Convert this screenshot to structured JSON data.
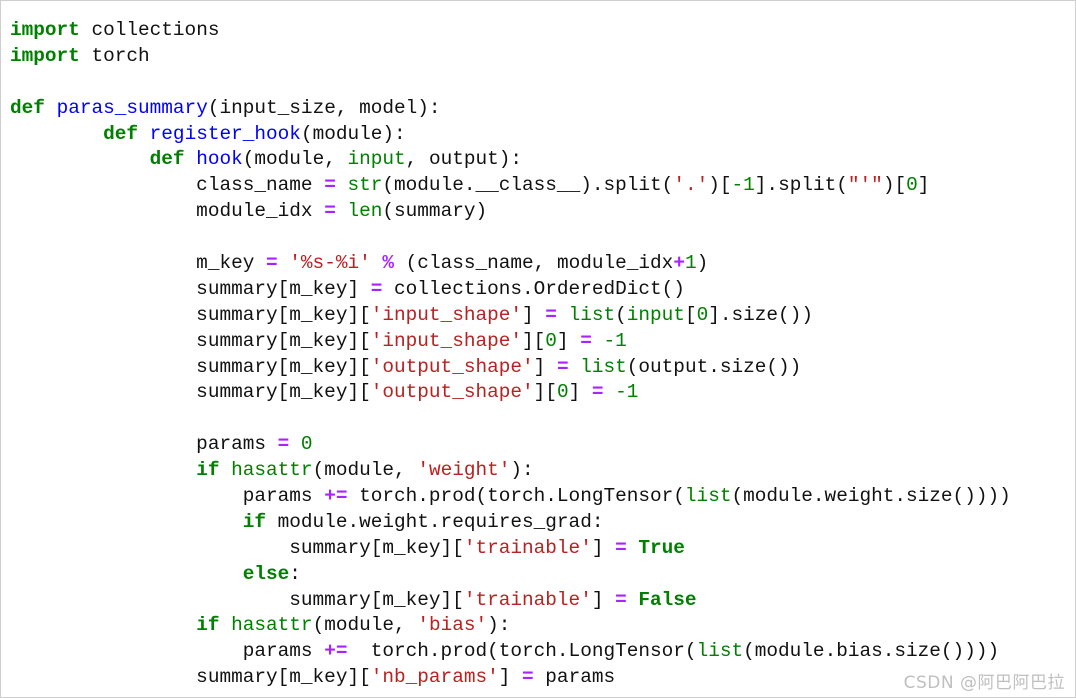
{
  "colors": {
    "keyword": "#008000",
    "function_name": "#0000ff",
    "string": "#ba2121",
    "operator": "#aa22ff",
    "text": "#111111",
    "watermark": "#bfbfbf"
  },
  "code_lines": [
    [
      [
        "kw",
        "import"
      ],
      [
        "plain",
        " collections"
      ]
    ],
    [
      [
        "kw",
        "import"
      ],
      [
        "plain",
        " torch"
      ]
    ],
    [],
    [
      [
        "kw",
        "def"
      ],
      [
        "plain",
        " "
      ],
      [
        "fn",
        "paras_summary"
      ],
      [
        "plain",
        "(input_size, model):"
      ]
    ],
    [
      [
        "plain",
        "        "
      ],
      [
        "kw",
        "def"
      ],
      [
        "plain",
        " "
      ],
      [
        "fn",
        "register_hook"
      ],
      [
        "plain",
        "(module):"
      ]
    ],
    [
      [
        "plain",
        "            "
      ],
      [
        "kw",
        "def"
      ],
      [
        "plain",
        " "
      ],
      [
        "fn",
        "hook"
      ],
      [
        "plain",
        "(module, "
      ],
      [
        "builtin",
        "input"
      ],
      [
        "plain",
        ", output):"
      ]
    ],
    [
      [
        "plain",
        "                class_name "
      ],
      [
        "op",
        "="
      ],
      [
        "plain",
        " "
      ],
      [
        "builtin",
        "str"
      ],
      [
        "plain",
        "(module.__class__).split("
      ],
      [
        "str",
        "'.'"
      ],
      [
        "plain",
        ")["
      ],
      [
        "num",
        "-1"
      ],
      [
        "plain",
        "].split("
      ],
      [
        "str",
        "\"'\""
      ],
      [
        "plain",
        ")["
      ],
      [
        "num",
        "0"
      ],
      [
        "plain",
        "]"
      ]
    ],
    [
      [
        "plain",
        "                module_idx "
      ],
      [
        "op",
        "="
      ],
      [
        "plain",
        " "
      ],
      [
        "builtin",
        "len"
      ],
      [
        "plain",
        "(summary)"
      ]
    ],
    [],
    [
      [
        "plain",
        "                m_key "
      ],
      [
        "op",
        "="
      ],
      [
        "plain",
        " "
      ],
      [
        "str",
        "'%s-%i'"
      ],
      [
        "plain",
        " "
      ],
      [
        "op",
        "%"
      ],
      [
        "plain",
        " (class_name, module_idx"
      ],
      [
        "op",
        "+"
      ],
      [
        "num",
        "1"
      ],
      [
        "plain",
        ")"
      ]
    ],
    [
      [
        "plain",
        "                summary[m_key] "
      ],
      [
        "op",
        "="
      ],
      [
        "plain",
        " collections.OrderedDict()"
      ]
    ],
    [
      [
        "plain",
        "                summary[m_key]["
      ],
      [
        "str",
        "'input_shape'"
      ],
      [
        "plain",
        "] "
      ],
      [
        "op",
        "="
      ],
      [
        "plain",
        " "
      ],
      [
        "builtin",
        "list"
      ],
      [
        "plain",
        "("
      ],
      [
        "builtin",
        "input"
      ],
      [
        "plain",
        "["
      ],
      [
        "num",
        "0"
      ],
      [
        "plain",
        "].size())"
      ]
    ],
    [
      [
        "plain",
        "                summary[m_key]["
      ],
      [
        "str",
        "'input_shape'"
      ],
      [
        "plain",
        "]["
      ],
      [
        "num",
        "0"
      ],
      [
        "plain",
        "] "
      ],
      [
        "op",
        "="
      ],
      [
        "plain",
        " "
      ],
      [
        "num",
        "-1"
      ]
    ],
    [
      [
        "plain",
        "                summary[m_key]["
      ],
      [
        "str",
        "'output_shape'"
      ],
      [
        "plain",
        "] "
      ],
      [
        "op",
        "="
      ],
      [
        "plain",
        " "
      ],
      [
        "builtin",
        "list"
      ],
      [
        "plain",
        "(output.size())"
      ]
    ],
    [
      [
        "plain",
        "                summary[m_key]["
      ],
      [
        "str",
        "'output_shape'"
      ],
      [
        "plain",
        "]["
      ],
      [
        "num",
        "0"
      ],
      [
        "plain",
        "] "
      ],
      [
        "op",
        "="
      ],
      [
        "plain",
        " "
      ],
      [
        "num",
        "-1"
      ]
    ],
    [],
    [
      [
        "plain",
        "                params "
      ],
      [
        "op",
        "="
      ],
      [
        "plain",
        " "
      ],
      [
        "num",
        "0"
      ]
    ],
    [
      [
        "plain",
        "                "
      ],
      [
        "kw",
        "if"
      ],
      [
        "plain",
        " "
      ],
      [
        "builtin",
        "hasattr"
      ],
      [
        "plain",
        "(module, "
      ],
      [
        "str",
        "'weight'"
      ],
      [
        "plain",
        "):"
      ]
    ],
    [
      [
        "plain",
        "                    params "
      ],
      [
        "op",
        "+="
      ],
      [
        "plain",
        " torch.prod(torch.LongTensor("
      ],
      [
        "builtin",
        "list"
      ],
      [
        "plain",
        "(module.weight.size())))"
      ]
    ],
    [
      [
        "plain",
        "                    "
      ],
      [
        "kw",
        "if"
      ],
      [
        "plain",
        " module.weight.requires_grad:"
      ]
    ],
    [
      [
        "plain",
        "                        summary[m_key]["
      ],
      [
        "str",
        "'trainable'"
      ],
      [
        "plain",
        "] "
      ],
      [
        "op",
        "="
      ],
      [
        "plain",
        " "
      ],
      [
        "const",
        "True"
      ]
    ],
    [
      [
        "plain",
        "                    "
      ],
      [
        "kw",
        "else"
      ],
      [
        "plain",
        ":"
      ]
    ],
    [
      [
        "plain",
        "                        summary[m_key]["
      ],
      [
        "str",
        "'trainable'"
      ],
      [
        "plain",
        "] "
      ],
      [
        "op",
        "="
      ],
      [
        "plain",
        " "
      ],
      [
        "const",
        "False"
      ]
    ],
    [
      [
        "plain",
        "                "
      ],
      [
        "kw",
        "if"
      ],
      [
        "plain",
        " "
      ],
      [
        "builtin",
        "hasattr"
      ],
      [
        "plain",
        "(module, "
      ],
      [
        "str",
        "'bias'"
      ],
      [
        "plain",
        "):"
      ]
    ],
    [
      [
        "plain",
        "                    params "
      ],
      [
        "op",
        "+="
      ],
      [
        "plain",
        "  torch.prod(torch.LongTensor("
      ],
      [
        "builtin",
        "list"
      ],
      [
        "plain",
        "(module.bias.size())))"
      ]
    ],
    [
      [
        "plain",
        "                summary[m_key]["
      ],
      [
        "str",
        "'nb_params'"
      ],
      [
        "plain",
        "] "
      ],
      [
        "op",
        "="
      ],
      [
        "plain",
        " params"
      ]
    ]
  ],
  "watermark": {
    "text": "CSDN @阿巴阿巴拉"
  }
}
